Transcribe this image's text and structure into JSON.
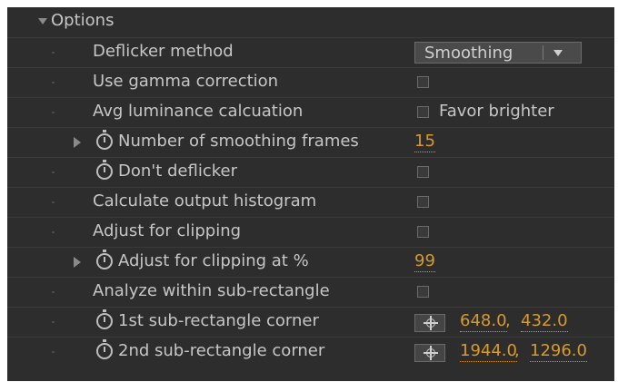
{
  "section": {
    "title": "Options"
  },
  "rows": [
    {
      "label": "Deflicker method",
      "control": "dropdown",
      "value": "Smoothing"
    },
    {
      "label": "Use gamma correction",
      "control": "checkbox"
    },
    {
      "label": "Avg luminance calcuation",
      "control": "checkbox",
      "checkbox_label": "Favor brighter"
    },
    {
      "label": "Number of smoothing frames",
      "control": "number",
      "value": "15"
    },
    {
      "label": "Don't deflicker",
      "control": "checkbox"
    },
    {
      "label": "Calculate output histogram",
      "control": "checkbox"
    },
    {
      "label": "Adjust for clipping",
      "control": "checkbox"
    },
    {
      "label": "Adjust for clipping at %",
      "control": "number",
      "value": "99"
    },
    {
      "label": "Analyze within sub-rectangle",
      "control": "checkbox"
    },
    {
      "label": "1st sub-rectangle corner",
      "control": "point",
      "x": "648.0",
      "y": "432.0"
    },
    {
      "label": "2nd sub-rectangle corner",
      "control": "point",
      "x": "1944.0",
      "y": "1296.0"
    }
  ],
  "point_separator": ", ",
  "colors": {
    "panel_bg": "#2d2d2d",
    "text": "#c6c6c6",
    "value_accent": "#d89a2a"
  },
  "icons": {
    "twirl_open": "triangle-down-icon",
    "twirl_closed": "triangle-right-icon",
    "stopwatch": "stopwatch-icon",
    "point": "crosshair-icon"
  }
}
